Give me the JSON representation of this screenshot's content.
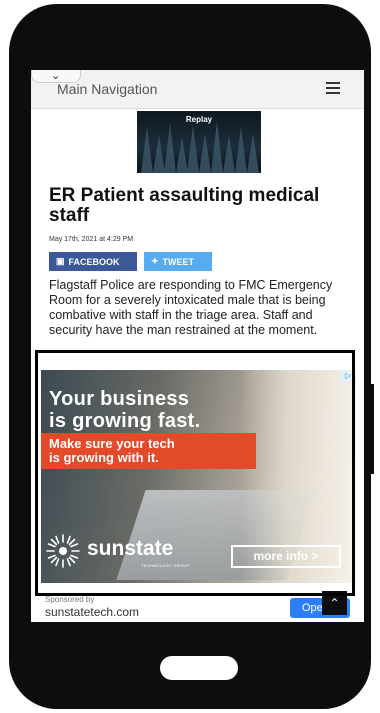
{
  "nav": {
    "title": "Main Navigation"
  },
  "video": {
    "overlay_label": "Replay"
  },
  "article": {
    "headline": "ER Patient assaulting medical staff",
    "date": "May 17th, 2021 at 4:29 PM",
    "share_facebook": "FACEBOOK",
    "share_twitter": "TWEET",
    "body": "Flagstaff Police are responding to FMC Emergency Room for a severely intoxicated male that is being combative with staff in the triage area. Staff and security have the man restrained at the moment."
  },
  "ad": {
    "line1": "Your business",
    "line2": "is growing fast.",
    "red_line1": "Make sure your tech",
    "red_line2": "is growing with it.",
    "brand": "sunstate",
    "brand_sub": "TECHNOLOGY GROUP",
    "cta": "more info >",
    "adchoices_glyph": "▷",
    "sponsored_label": "Sponsored by",
    "sponsor_url": "sunstatetech.com",
    "open_label": "Open",
    "colors": {
      "red_band": "#e24a2a",
      "open_button": "#2d7ff9"
    }
  },
  "icons": {
    "chevron": "chevron-down-icon",
    "menu": "hamburger-menu-icon",
    "scroll_top": "double-chevron-up-icon",
    "facebook": "facebook-icon",
    "twitter": "twitter-icon"
  }
}
